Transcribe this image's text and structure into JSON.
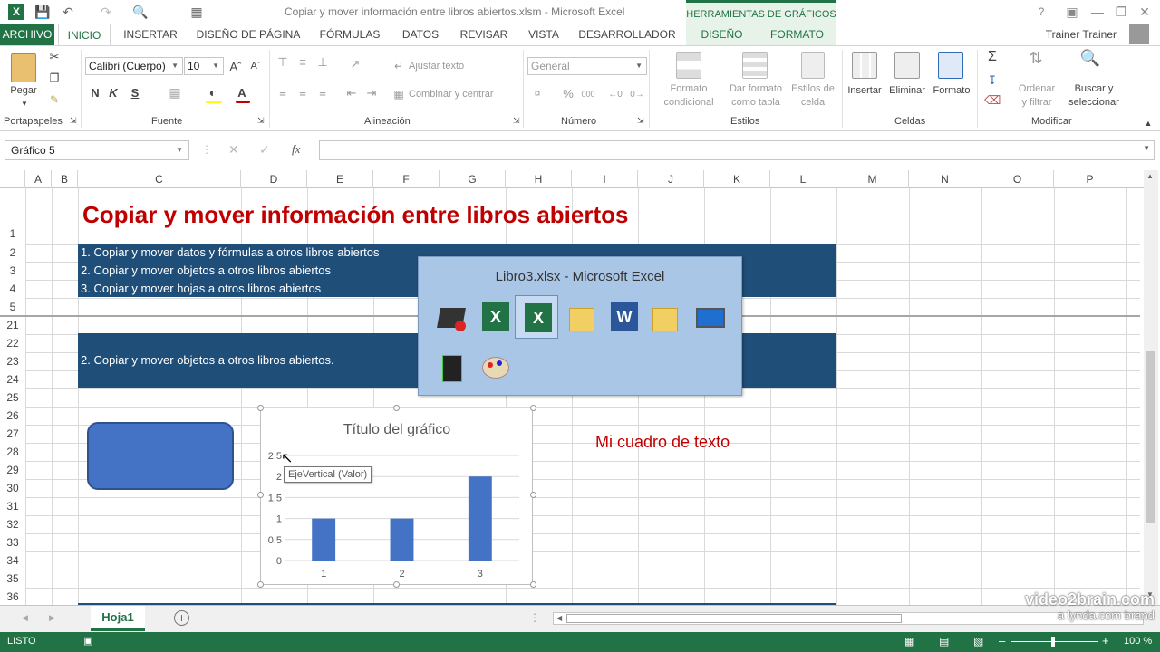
{
  "window": {
    "title": "Copiar y mover información entre libros abiertos.xlsm - Microsoft Excel",
    "chart_tools": "HERRAMIENTAS DE GRÁFICOS",
    "user": "Trainer Trainer"
  },
  "tabs": [
    "ARCHIVO",
    "INICIO",
    "INSERTAR",
    "DISEÑO DE PÁGINA",
    "FÓRMULAS",
    "DATOS",
    "REVISAR",
    "VISTA",
    "DESARROLLADOR",
    "DISEÑO",
    "FORMATO"
  ],
  "ribbon": {
    "paste": "Pegar",
    "font_name": "Calibri (Cuerpo)",
    "font_size": "10",
    "bold": "N",
    "italic": "K",
    "underline": "S",
    "wrap": "Ajustar texto",
    "merge": "Combinar y centrar",
    "number_format": "General",
    "percent": "%",
    "thousands": "000",
    "cond_format": [
      "Formato",
      "condicional"
    ],
    "format_table": [
      "Dar formato",
      "como tabla"
    ],
    "cell_styles": [
      "Estilos de",
      "celda"
    ],
    "insert": "Insertar",
    "delete": "Eliminar",
    "format": "Formato",
    "sort": [
      "Ordenar",
      "y filtrar"
    ],
    "find": [
      "Buscar y",
      "seleccionar"
    ],
    "groups": [
      "Portapapeles",
      "Fuente",
      "Alineación",
      "Número",
      "Estilos",
      "Celdas",
      "Modificar"
    ]
  },
  "formula": {
    "namebox": "Gráfico 5",
    "fx": "fx",
    "value": ""
  },
  "columns": [
    "A",
    "B",
    "C",
    "D",
    "E",
    "F",
    "G",
    "H",
    "I",
    "J",
    "K",
    "L",
    "M",
    "N",
    "O",
    "P"
  ],
  "rows": [
    "1",
    "2",
    "3",
    "4",
    "5",
    "21",
    "22",
    "23",
    "24",
    "25",
    "26",
    "27",
    "28",
    "29",
    "30",
    "31",
    "32",
    "33",
    "34",
    "35",
    "36"
  ],
  "sheet": {
    "title": "Copiar y mover información entre libros abiertos",
    "items": [
      "1. Copiar y mover datos y fórmulas a otros libros abiertos",
      "2. Copiar y mover objetos a otros libros abiertos",
      "3. Copiar y mover hojas a otros libros abiertos"
    ],
    "banner2": "2. Copiar y mover objetos a otros libros abiertos.",
    "textbox": "Mi cuadro de texto"
  },
  "switcher": {
    "title": "Libro3.xlsx - Microsoft Excel"
  },
  "tooltip": "EjeVertical (Valor)",
  "chart_data": {
    "type": "bar",
    "title": "Título del gráfico",
    "categories": [
      "1",
      "2",
      "3"
    ],
    "values": [
      1,
      1,
      2
    ],
    "yticks": [
      "0",
      "0,5",
      "1",
      "1,5",
      "2",
      "2,5"
    ],
    "ylim": [
      0,
      2.5
    ],
    "color": "#4472c4"
  },
  "sheet_tab": "Hoja1",
  "status": {
    "ready": "LISTO",
    "zoom": "100 %"
  },
  "watermark": [
    "video2brain.com",
    "a lynda.com brand"
  ]
}
